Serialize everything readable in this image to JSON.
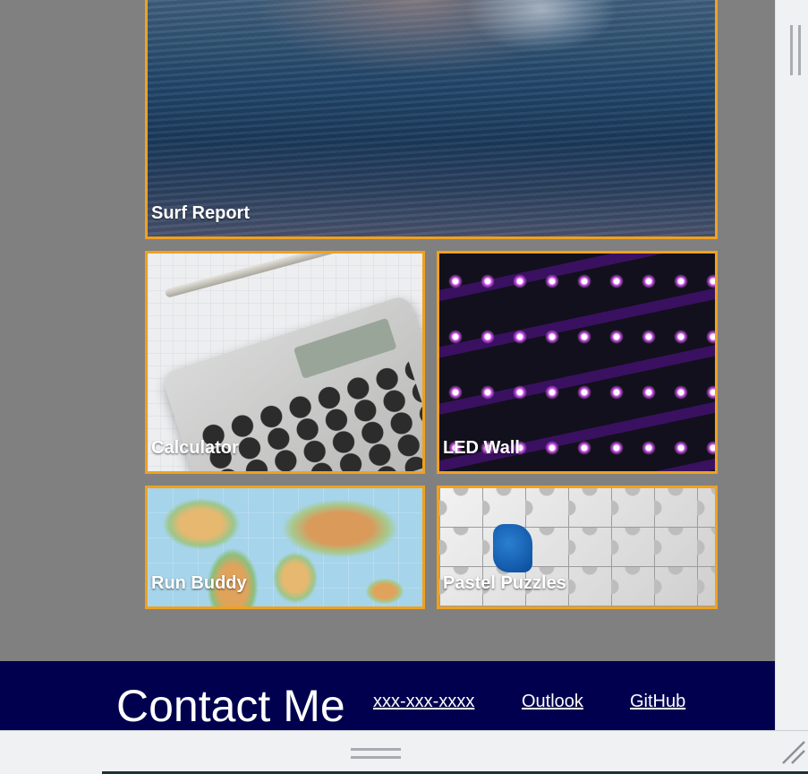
{
  "projects": [
    {
      "id": "surf",
      "title": "Surf Report"
    },
    {
      "id": "calc",
      "title": "Calculator"
    },
    {
      "id": "led",
      "title": "LED Wall"
    },
    {
      "id": "run",
      "title": "Run Buddy"
    },
    {
      "id": "puzzle",
      "title": "Pastel Puzzles"
    }
  ],
  "footer": {
    "heading": "Contact Me",
    "links": [
      {
        "label": "xxx-xxx-xxxx"
      },
      {
        "label": "Outlook"
      },
      {
        "label": "GitHub"
      }
    ]
  },
  "colors": {
    "page_background": "#808080",
    "card_border": "#f0a11e",
    "footer_background": "#00004f",
    "text": "#ffffff"
  }
}
